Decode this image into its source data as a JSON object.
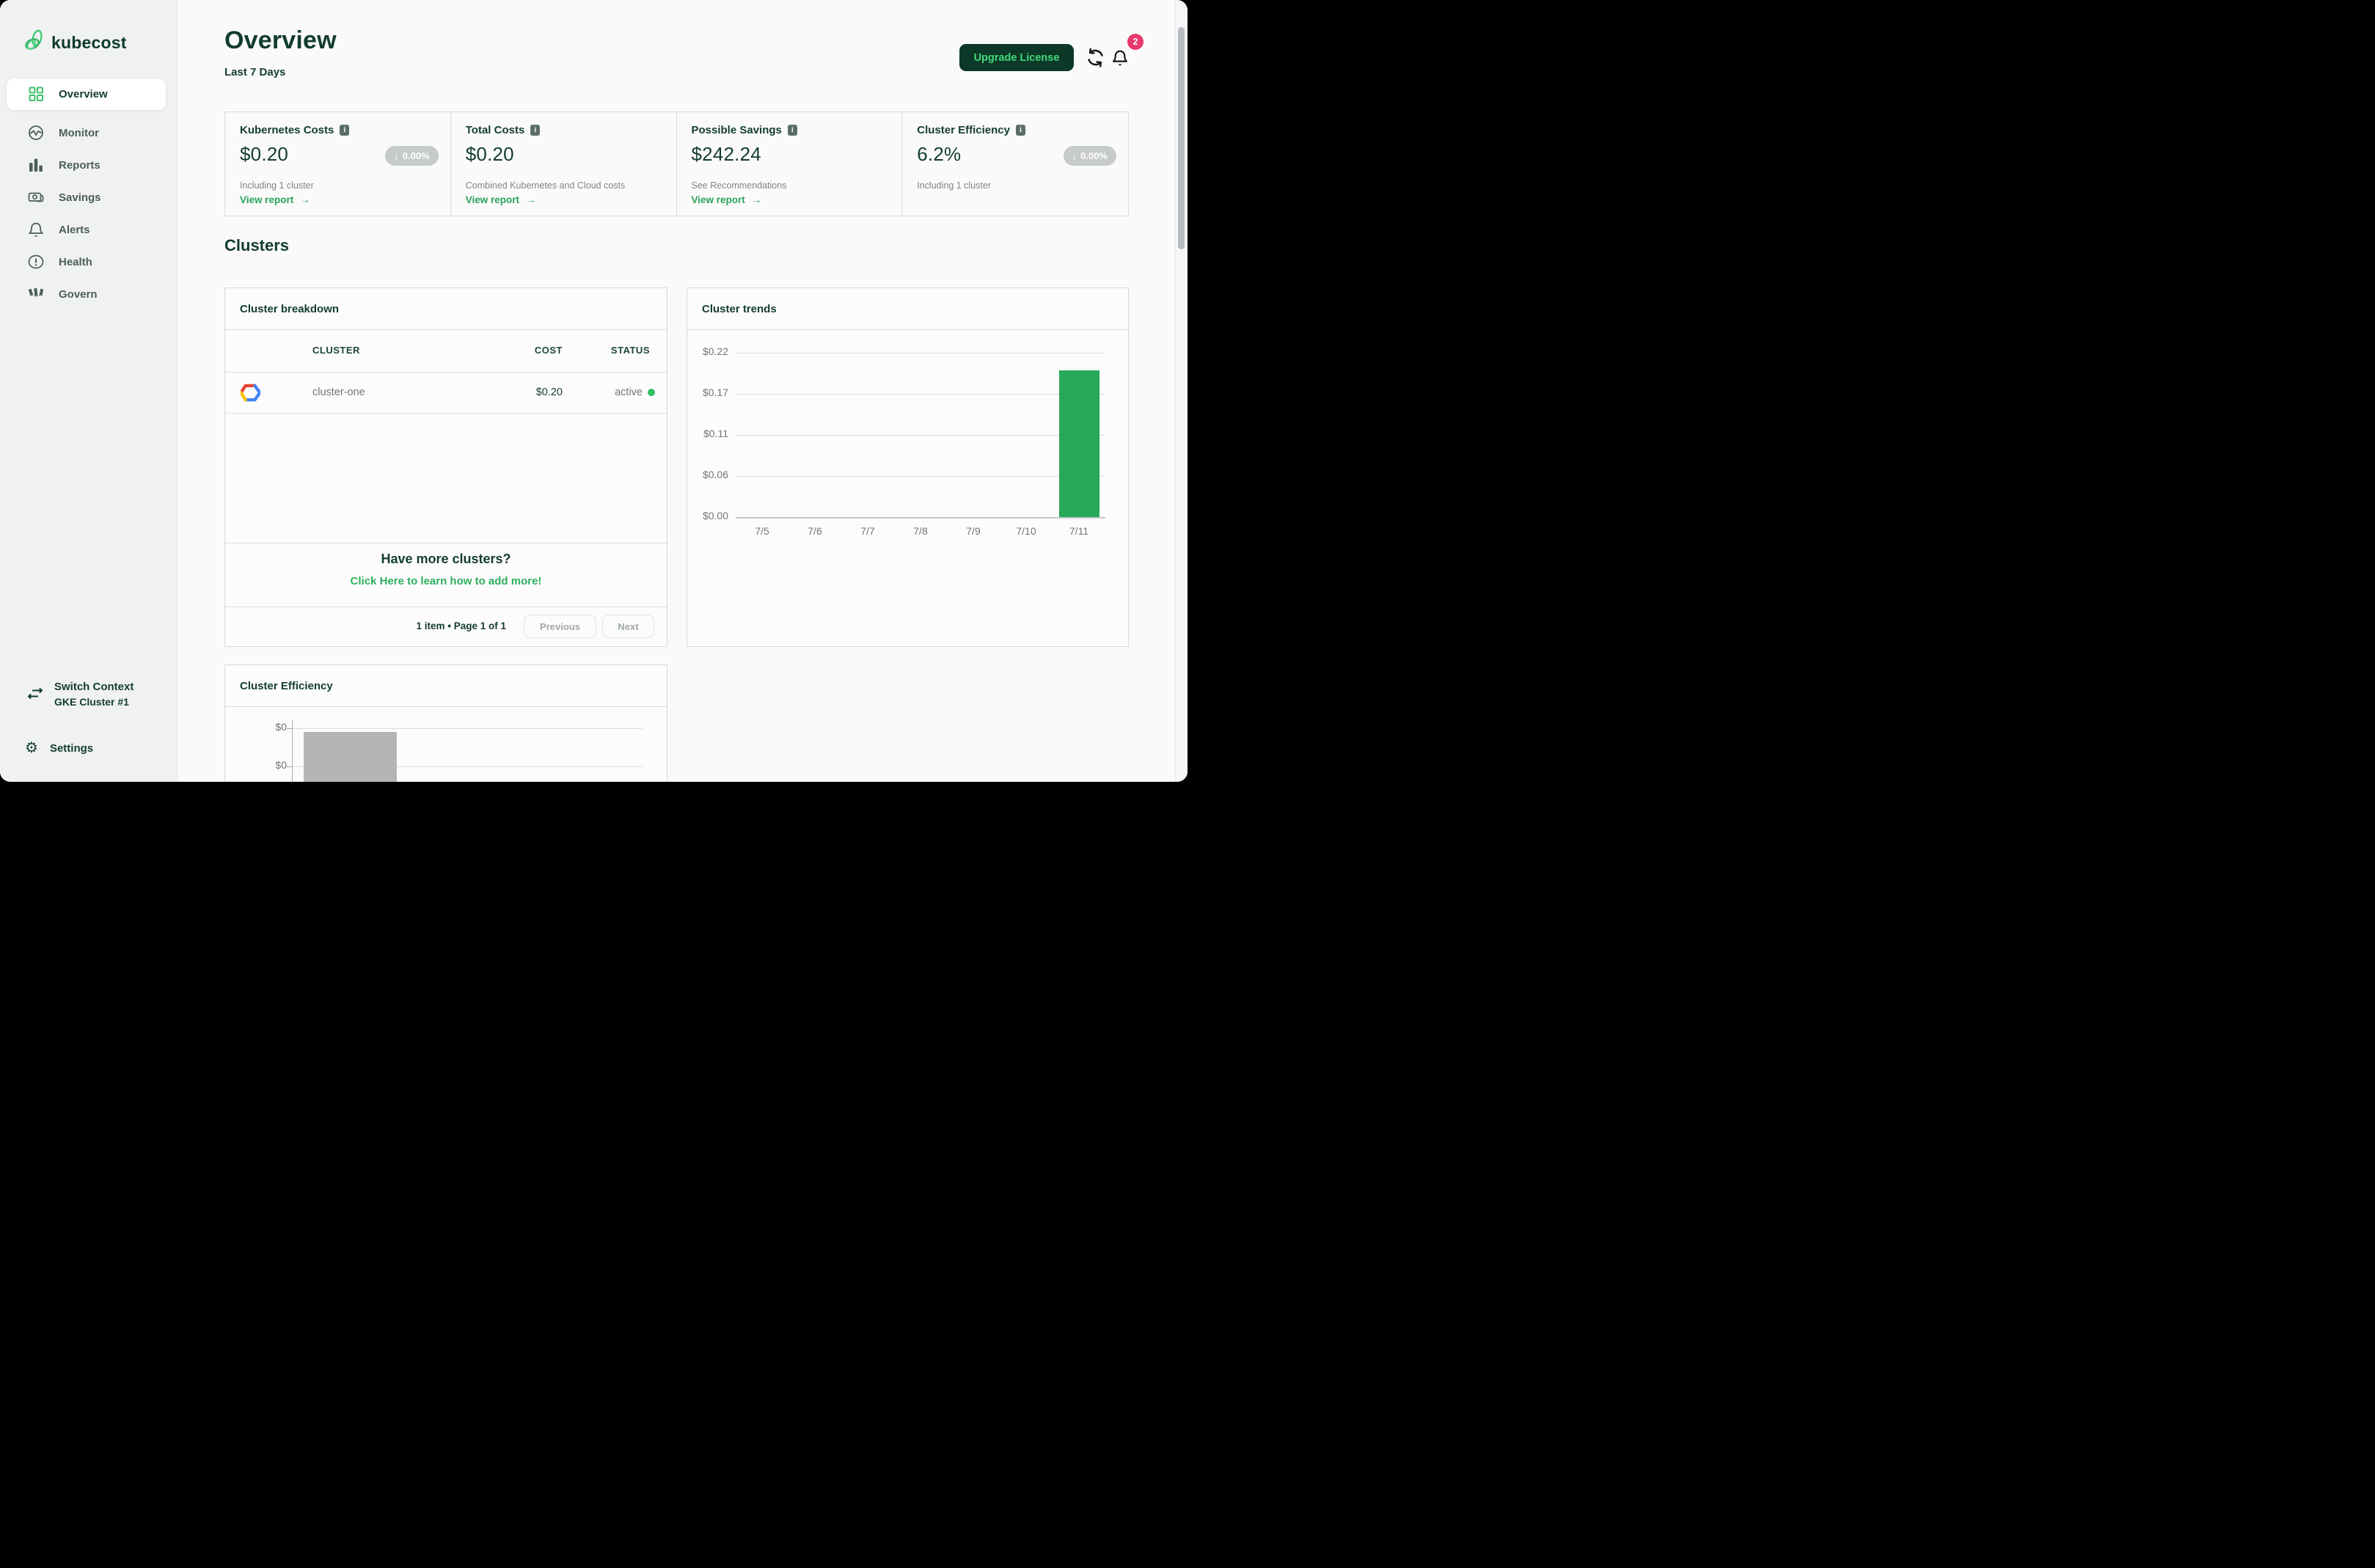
{
  "sidebar": {
    "logo_label": "kubecost",
    "items": [
      {
        "label": "Overview",
        "icon": "grid-icon",
        "active": true
      },
      {
        "label": "Monitor",
        "icon": "monitor-icon"
      },
      {
        "label": "Reports",
        "icon": "bar-chart-icon"
      },
      {
        "label": "Savings",
        "icon": "money-icon"
      },
      {
        "label": "Alerts",
        "icon": "bell-icon"
      },
      {
        "label": "Health",
        "icon": "health-icon"
      },
      {
        "label": "Govern",
        "icon": "flags-icon"
      }
    ],
    "switch_context": {
      "label": "Switch Context",
      "value": "GKE Cluster #1"
    },
    "settings_label": "Settings"
  },
  "header": {
    "title": "Overview",
    "period": "Last 7 Days",
    "upgrade_button": "Upgrade License",
    "notification_count": "2"
  },
  "stat_cards": [
    {
      "title": "Kubernetes Costs",
      "value": "$0.20",
      "delta": "0.00%",
      "delta_direction": "down",
      "subtitle": "Including 1 cluster",
      "link_label": "View report"
    },
    {
      "title": "Total Costs",
      "value": "$0.20",
      "subtitle": "Combined Kubernetes and Cloud costs",
      "link_label": "View report"
    },
    {
      "title": "Possible Savings",
      "value": "$242.24",
      "subtitle": "See Recommendations",
      "link_label": "View report"
    },
    {
      "title": "Cluster Efficiency",
      "value": "6.2%",
      "delta": "0.00%",
      "delta_direction": "down",
      "subtitle": "Including 1 cluster"
    }
  ],
  "clusters": {
    "heading": "Clusters",
    "breakdown": {
      "title": "Cluster breakdown",
      "columns": [
        "CLUSTER",
        "COST",
        "STATUS"
      ],
      "rows": [
        {
          "provider_icon": "gcp-logo",
          "cluster": "cluster-one",
          "cost": "$0.20",
          "status": "active",
          "status_color": "#2fbe62"
        }
      ],
      "empty_prompt": "Have more clusters?",
      "empty_link": "Click Here to learn how to add more!",
      "pagination": {
        "summary": "1 item • Page 1 of 1",
        "previous_label": "Previous",
        "next_label": "Next"
      }
    },
    "trends": {
      "title": "Cluster trends",
      "chart_data": {
        "type": "bar",
        "categories": [
          "7/5",
          "7/6",
          "7/7",
          "7/8",
          "7/9",
          "7/10",
          "7/11"
        ],
        "values": [
          0,
          0,
          0,
          0,
          0,
          0,
          0.2
        ],
        "ytick_labels": [
          "$0.22",
          "$0.17",
          "$0.11",
          "$0.06",
          "$0.00"
        ],
        "ytick_values": [
          0.224,
          0.168,
          0.112,
          0.056,
          0
        ],
        "ylim": [
          0,
          0.224
        ],
        "bar_color": "#27a959",
        "grid": true
      }
    },
    "efficiency": {
      "title": "Cluster Efficiency",
      "chart_data": {
        "type": "bar",
        "ytick_labels": [
          "$0",
          "$0"
        ],
        "bar_color": "#b5b5b5",
        "note": "chart truncated at window bottom; one gray bar visible"
      }
    }
  },
  "colors": {
    "dark_green": "#123c30",
    "accent_green": "#2fae5e",
    "bright_green": "#43d87b",
    "badge_pink": "#e8386d",
    "pill_gray": "#c6cac9",
    "sidebar_bg": "#f0f2f1"
  }
}
